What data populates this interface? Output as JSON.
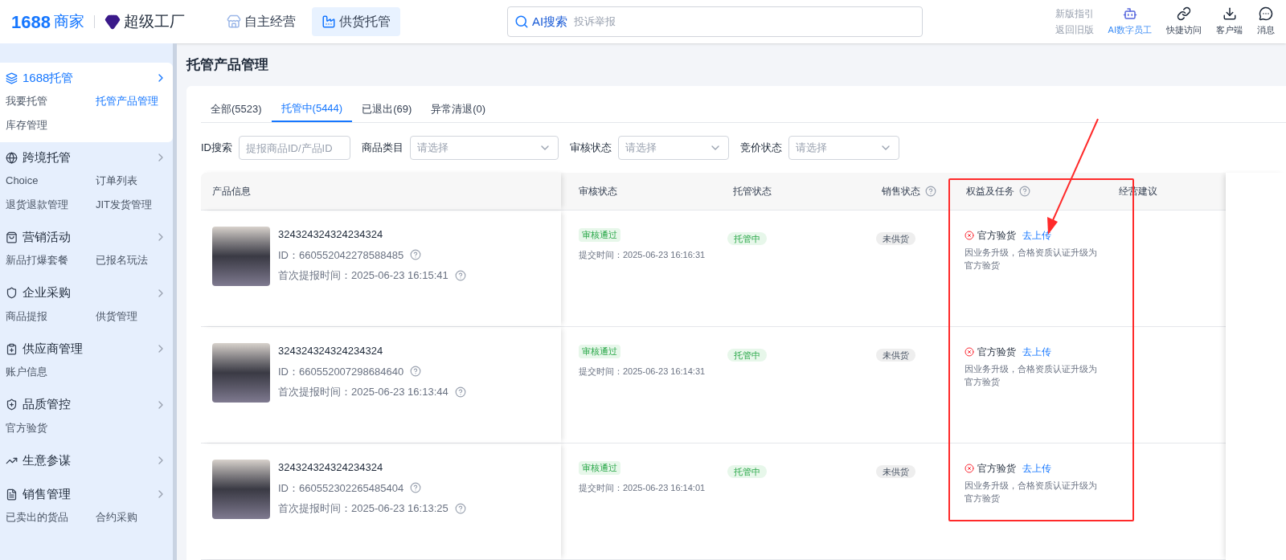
{
  "header": {
    "logo_number": "1688",
    "logo_text": "商家",
    "brand": "超级工厂",
    "nav": [
      {
        "label": "自主经营",
        "selected": false
      },
      {
        "label": "供货托管",
        "selected": true
      }
    ],
    "search": {
      "label": "AI搜索",
      "placeholder": "投诉举报"
    },
    "links": [
      "新版指引",
      "返回旧版"
    ],
    "tools": [
      {
        "kind": "bot",
        "label": "AI数字员工"
      },
      {
        "kind": "link",
        "label": "快捷访问"
      },
      {
        "kind": "download",
        "label": "客户端"
      },
      {
        "kind": "message",
        "label": "消息"
      }
    ]
  },
  "sidebar": [
    {
      "kind": "hosting",
      "title": "1688托管",
      "active": true,
      "items": [
        {
          "label": "我要托管",
          "selected": false
        },
        {
          "label": "托管产品管理",
          "selected": true
        },
        {
          "label": "库存管理",
          "selected": false
        }
      ]
    },
    {
      "kind": "globe",
      "title": "跨境托管",
      "active": false,
      "items": [
        {
          "label": "Choice",
          "selected": false
        },
        {
          "label": "订单列表",
          "selected": false
        },
        {
          "label": "退货退款管理",
          "selected": false
        },
        {
          "label": "JIT发货管理",
          "selected": false
        }
      ]
    },
    {
      "kind": "bag",
      "title": "营销活动",
      "active": false,
      "items": [
        {
          "label": "新品打爆套餐",
          "selected": false
        },
        {
          "label": "已报名玩法",
          "selected": false
        }
      ]
    },
    {
      "kind": "shield",
      "title": "企业采购",
      "active": false,
      "items": [
        {
          "label": "商品提报",
          "selected": false
        },
        {
          "label": "供货管理",
          "selected": false
        }
      ]
    },
    {
      "kind": "clipboard",
      "title": "供应商管理",
      "active": false,
      "items": [
        {
          "label": "账户信息",
          "selected": false
        }
      ]
    },
    {
      "kind": "shieldplus",
      "title": "品质管控",
      "active": false,
      "items": [
        {
          "label": "官方验货",
          "selected": false
        }
      ]
    },
    {
      "kind": "trend",
      "title": "生意参谋",
      "active": false
    },
    {
      "kind": "file",
      "title": "销售管理",
      "active": false,
      "items": [
        {
          "label": "已卖出的货品",
          "selected": false
        },
        {
          "label": "合约采购",
          "selected": false
        }
      ]
    }
  ],
  "page_title": "托管产品管理",
  "tabs": [
    {
      "label": "全部(5523)",
      "selected": false
    },
    {
      "label": "托管中(5444)",
      "selected": true
    },
    {
      "label": "已退出(69)",
      "selected": false
    },
    {
      "label": "异常清退(0)",
      "selected": false
    }
  ],
  "filters": [
    {
      "kind": "input",
      "label": "ID搜索",
      "placeholder": "提报商品ID/产品ID"
    },
    {
      "kind": "select",
      "label": "商品类目",
      "placeholder": "请选择"
    },
    {
      "kind": "select",
      "label": "审核状态",
      "placeholder": "请选择"
    },
    {
      "kind": "select",
      "label": "竞价状态",
      "placeholder": "请选择"
    }
  ],
  "table": {
    "columns": [
      {
        "label": "产品信息",
        "help": false
      },
      {
        "label": "审核状态",
        "help": false
      },
      {
        "label": "托管状态",
        "help": false
      },
      {
        "label": "销售状态",
        "help": true
      },
      {
        "label": "权益及任务",
        "help": true
      },
      {
        "label": "经营建议",
        "help": false
      }
    ],
    "rows": [
      {
        "title": "324324324324234324",
        "id": "ID：660552042278588485",
        "first_time": "首次提报时间：2025-06-23 16:15:41",
        "audit": "审核通过",
        "submit_time": "提交时间：2025-06-23 16:16:31",
        "hosting": "托管中",
        "sale": "未供货",
        "task": "官方验货",
        "task_link": "去上传",
        "task_desc": "因业务升级，合格资质认证升级为官方验货"
      },
      {
        "title": "324324324324234324",
        "id": "ID：660552007298684640",
        "first_time": "首次提报时间：2025-06-23 16:13:44",
        "audit": "审核通过",
        "submit_time": "提交时间：2025-06-23 16:14:31",
        "hosting": "托管中",
        "sale": "未供货",
        "task": "官方验货",
        "task_link": "去上传",
        "task_desc": "因业务升级，合格资质认证升级为官方验货"
      },
      {
        "title": "324324324324234324",
        "id": "ID：660552302265485404",
        "first_time": "首次提报时间：2025-06-23 16:13:25",
        "audit": "审核通过",
        "submit_time": "提交时间：2025-06-23 16:14:01",
        "hosting": "托管中",
        "sale": "未供货",
        "task": "官方验货",
        "task_link": "去上传",
        "task_desc": "因业务升级，合格资质认证升级为官方验货"
      }
    ]
  }
}
